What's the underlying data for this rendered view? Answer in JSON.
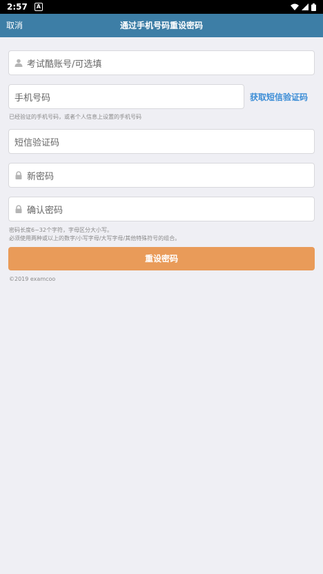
{
  "status_bar": {
    "time": "2:57",
    "notification_glyph": "A"
  },
  "nav": {
    "cancel_label": "取消",
    "title": "通过手机号码重设密码"
  },
  "form": {
    "account_placeholder": "考试酷账号/可选填",
    "phone_placeholder": "手机号码",
    "sms_button_label": "获取短信验证码",
    "phone_hint": "已经验证的手机号码，或者个人信息上设置的手机号码",
    "code_placeholder": "短信验证码",
    "new_password_placeholder": "新密码",
    "confirm_password_placeholder": "确认密码",
    "password_hint_1": "密码长度6~32个字符，字母区分大小写。",
    "password_hint_2": "必须使用两种或以上的数字/小写字母/大写字母/其他特殊符号的组合。",
    "submit_label": "重设密码"
  },
  "footer": {
    "copyright": "©2019 examcoo"
  },
  "colors": {
    "nav_bg": "#3d7ea6",
    "accent_link": "#3c8dd6",
    "submit_bg": "#e99b59",
    "page_bg": "#efeff4"
  }
}
